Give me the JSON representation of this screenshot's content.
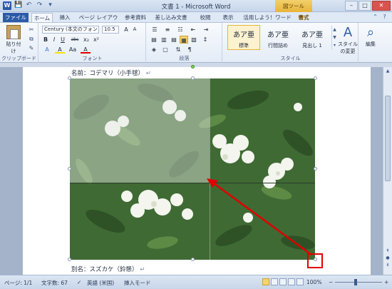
{
  "window": {
    "app_icon": "W",
    "title": "文書 1 - Microsoft Word",
    "tools_tab": "図ツール",
    "buttons": [
      "–",
      "□",
      "✕"
    ]
  },
  "qat": [
    "💾",
    "↶",
    "↷",
    "▾"
  ],
  "tabs": [
    "ファイル",
    "ホーム",
    "挿入",
    "ページ レイアウト",
    "参考資料",
    "差し込み文書",
    "校閲",
    "表示",
    "活用しよう！ワード",
    "書式"
  ],
  "ribbon": {
    "clipboard": {
      "paste_label": "貼り付け",
      "group_label": "クリップボード"
    },
    "font": {
      "font_name": "Century (本文のフォント -",
      "font_size": "10.5",
      "group_label": "フォント",
      "buttons": [
        "B",
        "I",
        "U",
        "abc",
        "x₂",
        "x²",
        "A",
        "A",
        "Aa",
        "A"
      ]
    },
    "paragraph": {
      "group_label": "段落"
    },
    "styles": {
      "group_label": "スタイル",
      "items": [
        {
          "sample": "あア亜",
          "name": "標準"
        },
        {
          "sample": "あア亜",
          "name": "行間詰め"
        },
        {
          "sample": "あア亜",
          "name": "見出し 1"
        }
      ],
      "change_label": "スタイルの変更"
    },
    "editing": {
      "label": "編集"
    }
  },
  "document": {
    "line1": "名前：コデマリ（小手毬）",
    "line2": "別名：スズカケ（鈴懸）",
    "para_mark": "↵"
  },
  "status": {
    "page": "ページ: 1/1",
    "words": "文字数: 67",
    "language": "英語 (米国)",
    "mode": "挿入モード",
    "zoom": "100%",
    "zoom_minus": "−",
    "zoom_plus": "+"
  }
}
